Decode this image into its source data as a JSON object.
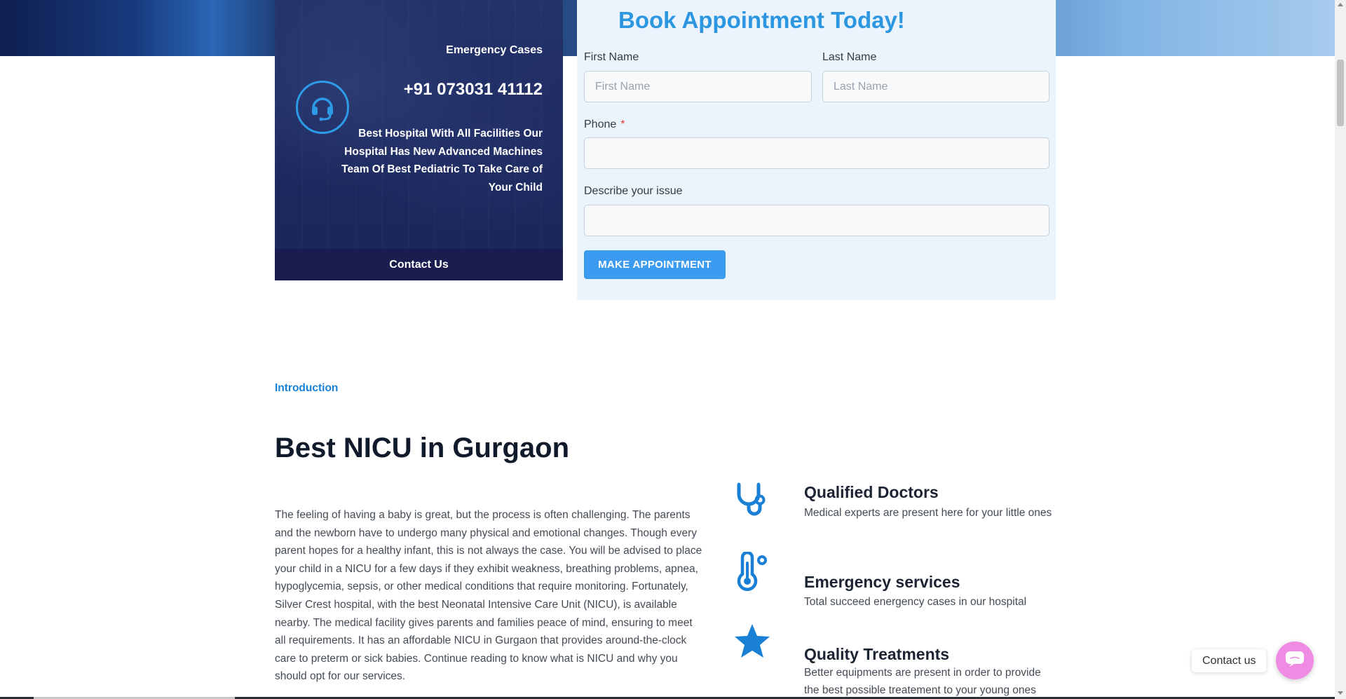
{
  "emergency": {
    "label": "Emergency Cases",
    "phone": "+91 073031 41112",
    "description": "Best Hospital With All Facilities Our Hospital Has New Advanced Machines Team Of Best Pediatric To Take Care of Your Child",
    "contact_button": "Contact Us",
    "icon": "headset-icon"
  },
  "booking": {
    "title": "Book Appointment Today!",
    "first_name_label": "First Name",
    "first_name_placeholder": "First Name",
    "last_name_label": "Last Name",
    "last_name_placeholder": "Last Name",
    "phone_label": "Phone",
    "phone_required": "*",
    "issue_label": "Describe your issue",
    "submit_label": "MAKE APPOINTMENT"
  },
  "intro": {
    "label": "Introduction",
    "title": "Best NICU in Gurgaon",
    "paragraph": "The feeling of having a baby is great, but the process is often challenging. The parents and the newborn have to undergo many physical and emotional changes. Though every parent hopes for a healthy infant, this is not always the case. You will be advised to place your child in a NICU for a few days if they exhibit weakness, breathing problems, apnea, hypoglycemia, sepsis, or other medical conditions that require monitoring. Fortunately, Silver Crest hospital, with the best Neonatal Intensive Care Unit (NICU), is available nearby. The medical facility gives parents and families peace of mind, ensuring to meet all requirements. It has an affordable NICU in Gurgaon that provides around-the-clock care to preterm or sick babies. Continue reading to know what is NICU and why you should opt for our services."
  },
  "features": [
    {
      "icon": "stethoscope-icon",
      "title": "Qualified Doctors",
      "description": "Medical experts are present here for your little ones"
    },
    {
      "icon": "thermometer-icon",
      "title": "Emergency services",
      "description": "Total succeed energency cases in our hospital"
    },
    {
      "icon": "star-icon",
      "title": "Quality Treatments",
      "description": "Better equipments are present in order to provide the best possible treatement to your young ones"
    }
  ],
  "floating_contact": {
    "label": "Contact us",
    "icon": "chat-icon"
  },
  "colors": {
    "accent": "#2c97e0",
    "card_dark": "#1b1c4f",
    "form_bg": "#ebf4fd",
    "floating": "#f08be4"
  }
}
